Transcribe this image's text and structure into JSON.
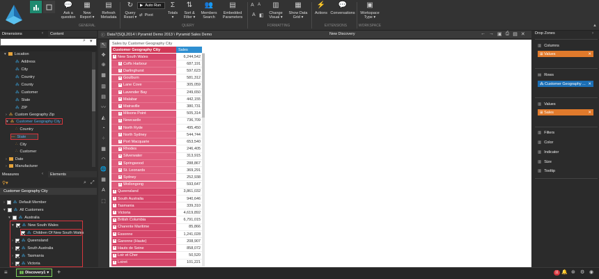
{
  "ribbon": {
    "buttons": [
      {
        "label1": "Ask a",
        "label2": "question",
        "icon": "chat-icon"
      },
      {
        "label1": "New",
        "label2": "Report ▾",
        "icon": "new-report-icon"
      },
      {
        "label1": "Refresh",
        "label2": "Metadata",
        "icon": "refresh-icon"
      },
      {
        "label1": "Query",
        "label2": "Reset ▾",
        "icon": "reset-icon"
      },
      {
        "label1": "Totals",
        "label2": "▾",
        "icon": "totals-icon"
      },
      {
        "label1": "Sort &",
        "label2": "Filter ▾",
        "icon": "sort-icon"
      },
      {
        "label1": "Members",
        "label2": "Search",
        "icon": "members-icon"
      },
      {
        "label1": "Embedded",
        "label2": "Parameters",
        "icon": "params-icon"
      },
      {
        "label1": "Change",
        "label2": "Visual ▾",
        "icon": "visual-icon"
      },
      {
        "label1": "Show Data",
        "label2": "Grid ▾",
        "icon": "grid-icon"
      },
      {
        "label1": "Actions",
        "label2": "",
        "icon": "actions-icon"
      },
      {
        "label1": "Conversations",
        "label2": "",
        "icon": "conversations-icon"
      },
      {
        "label1": "Workspace",
        "label2": "Type ▾",
        "icon": "workspace-icon"
      }
    ],
    "auto_run": "Auto Run",
    "pivot": "Pivot",
    "groups": {
      "general": "GENERAL",
      "query": "QUERY",
      "formatting": "FORMATTING",
      "extensions": "EXTENSIONS",
      "workspace": "WORKSPACE"
    }
  },
  "left": {
    "tab_dimensions": "Dimensions",
    "tab_content": "Content",
    "search_placeholder": "",
    "tree": [
      {
        "label": "Location",
        "indent": 0,
        "type": "folder"
      },
      {
        "label": "Address",
        "indent": 1,
        "type": "attr"
      },
      {
        "label": "City",
        "indent": 1,
        "type": "attr"
      },
      {
        "label": "Country",
        "indent": 1,
        "type": "attr"
      },
      {
        "label": "County",
        "indent": 1,
        "type": "attr"
      },
      {
        "label": "Customer",
        "indent": 1,
        "type": "attr"
      },
      {
        "label": "State",
        "indent": 1,
        "type": "attr"
      },
      {
        "label": "ZIP",
        "indent": 1,
        "type": "attr"
      },
      {
        "label": "Custom Geography Zip",
        "indent": 0,
        "type": "hier"
      },
      {
        "label": "Customer Geography City",
        "indent": 0,
        "type": "hier-sel"
      },
      {
        "label": "Country",
        "indent": 1,
        "type": "level"
      },
      {
        "label": "State",
        "indent": 1,
        "type": "level-sel"
      },
      {
        "label": "City",
        "indent": 1,
        "type": "level"
      },
      {
        "label": "Customer",
        "indent": 1,
        "type": "level"
      },
      {
        "label": "Date",
        "indent": 0,
        "type": "folder"
      },
      {
        "label": "Manufacturer",
        "indent": 0,
        "type": "folder"
      }
    ],
    "tab_measures": "Measures",
    "tab_elements": "Elements",
    "member_title": "Customer Geography City",
    "members": [
      {
        "label": "Default Member",
        "indent": 0,
        "checked": false
      },
      {
        "label": "All Customers",
        "indent": 0,
        "checked": false
      },
      {
        "label": "Australia",
        "indent": 1,
        "checked": false
      },
      {
        "label": "New South Wales",
        "indent": 2,
        "checked": true
      },
      {
        "label": "Children Of New South Wales",
        "indent": 3,
        "checked": true
      },
      {
        "label": "Queensland",
        "indent": 2,
        "checked": true
      },
      {
        "label": "South Australia",
        "indent": 2,
        "checked": true
      },
      {
        "label": "Tasmania",
        "indent": 2,
        "checked": true
      },
      {
        "label": "Victoria",
        "indent": 2,
        "checked": true
      }
    ]
  },
  "main": {
    "breadcrumb": "Data7(SQL2014 \\ Pyramid Demo 2013 \\ Pyramid Sales Demo",
    "title": "New Discovery",
    "grid_title": "Sales by Customer Geography City",
    "col_header": "Customer Geography City",
    "val_header": "Sales",
    "rows": [
      {
        "label": "New South Wales",
        "value": "6,244,542",
        "level": 0
      },
      {
        "label": "Coffs Harbour",
        "value": "687,191",
        "level": 1
      },
      {
        "label": "Darlinghurst",
        "value": "597,623",
        "level": 1
      },
      {
        "label": "Goulburn",
        "value": "581,312",
        "level": 1
      },
      {
        "label": "Lane Cove",
        "value": "305,059",
        "level": 1
      },
      {
        "label": "Lavender Bay",
        "value": "249,650",
        "level": 1
      },
      {
        "label": "Malabar",
        "value": "442,155",
        "level": 1
      },
      {
        "label": "Matraville",
        "value": "380,731",
        "level": 1
      },
      {
        "label": "Milsons Point",
        "value": "505,314",
        "level": 1
      },
      {
        "label": "Newcastle",
        "value": "736,709",
        "level": 1
      },
      {
        "label": "North Ryde",
        "value": "495,450",
        "level": 1
      },
      {
        "label": "North Sydney",
        "value": "544,744",
        "level": 1
      },
      {
        "label": "Port Macquarie",
        "value": "653,540",
        "level": 1
      },
      {
        "label": "Rhodes",
        "value": "246,405",
        "level": 1
      },
      {
        "label": "Silverwater",
        "value": "313,915",
        "level": 1
      },
      {
        "label": "Springwood",
        "value": "288,867",
        "level": 1
      },
      {
        "label": "St. Leonards",
        "value": "369,291",
        "level": 1
      },
      {
        "label": "Sydney",
        "value": "252,938",
        "level": 1
      },
      {
        "label": "Wollongong",
        "value": "593,647",
        "level": 1
      },
      {
        "label": "Queensland",
        "value": "3,861,032",
        "level": 0
      },
      {
        "label": "South Australia",
        "value": "940,646",
        "level": 0
      },
      {
        "label": "Tasmania",
        "value": "339,310",
        "level": 0
      },
      {
        "label": "Victoria",
        "value": "4,619,892",
        "level": 0
      },
      {
        "label": "British Columbia",
        "value": "6,791,015",
        "level": 0
      },
      {
        "label": "Charente Maritime",
        "value": "85,866",
        "level": 0
      },
      {
        "label": "Essonne",
        "value": "1,241,028",
        "level": 0
      },
      {
        "label": "Garonne (Haute)",
        "value": "208,907",
        "level": 0
      },
      {
        "label": "Hauts de Seine",
        "value": "858,072",
        "level": 0
      },
      {
        "label": "Loir et Cher",
        "value": "50,520",
        "level": 0
      },
      {
        "label": "Loiret",
        "value": "101,221",
        "level": 0
      }
    ]
  },
  "dropzones": {
    "title": "Drop Zones",
    "columns": "Columns",
    "columns_chip": "Values",
    "rows": "Rows",
    "rows_chip": "Customer Geography ...",
    "values": "Values",
    "values_chip": "Sales",
    "filters": "Filters",
    "color": "Color",
    "indicator": "Indicator",
    "size": "Size",
    "tooltip": "Tooltip"
  },
  "bottom": {
    "tab": "Discovery1",
    "badge": "11"
  },
  "colors": {
    "accent": "#1f8a70",
    "row_header": "#d6466a",
    "value_header": "#2e8fd1",
    "orange": "#e07a2c",
    "blue_chip": "#1c6fb5"
  }
}
